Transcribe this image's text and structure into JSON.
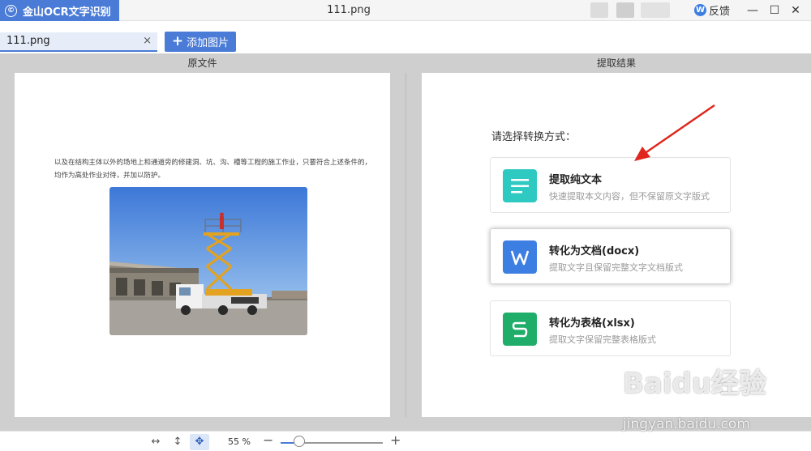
{
  "app": {
    "name": "金山OCR文字识别",
    "logo_glyph": "©"
  },
  "window": {
    "title": "111.png",
    "minimize": "—",
    "maximize": "☐",
    "close": "✕"
  },
  "feedback": {
    "label": "反馈",
    "icon": "W"
  },
  "tabs": [
    {
      "label": "111.png",
      "close": "×"
    }
  ],
  "add_button": {
    "label": "添加图片",
    "icon": "+"
  },
  "panels": {
    "left_title": "原文件",
    "right_title": "提取结果"
  },
  "document": {
    "text": "以及在结构主体以外的场地上和通道旁的修建洞、坑、沟、槽等工程的施工作业，只要符合上述条件的，均作为高处作业对待，并加以防护。"
  },
  "extract": {
    "prompt": "请选择转换方式：",
    "options": [
      {
        "title": "提取纯文本",
        "desc": "快速提取本文内容，但不保留原文字版式",
        "icon": "text-lines-icon",
        "color": "#2ec9c1",
        "selected": false
      },
      {
        "title": "转化为文档(docx)",
        "desc": "提取文字且保留完整文字文档版式",
        "icon": "W",
        "color": "#3d7ee3",
        "selected": true
      },
      {
        "title": "转化为表格(xlsx)",
        "desc": "提取文字保留完整表格版式",
        "icon": "S",
        "color": "#1fae6a",
        "selected": false
      }
    ]
  },
  "bottombar": {
    "fit_width_icon": "↔",
    "fit_height_icon": "↕",
    "move_icon": "✥",
    "zoom_value": "55 %",
    "zoom_minus": "−",
    "zoom_plus": "+",
    "zoom_fraction": 0.18
  },
  "watermark": {
    "line1": "Baidu经验",
    "line2": "jingyan.baidu.com"
  }
}
